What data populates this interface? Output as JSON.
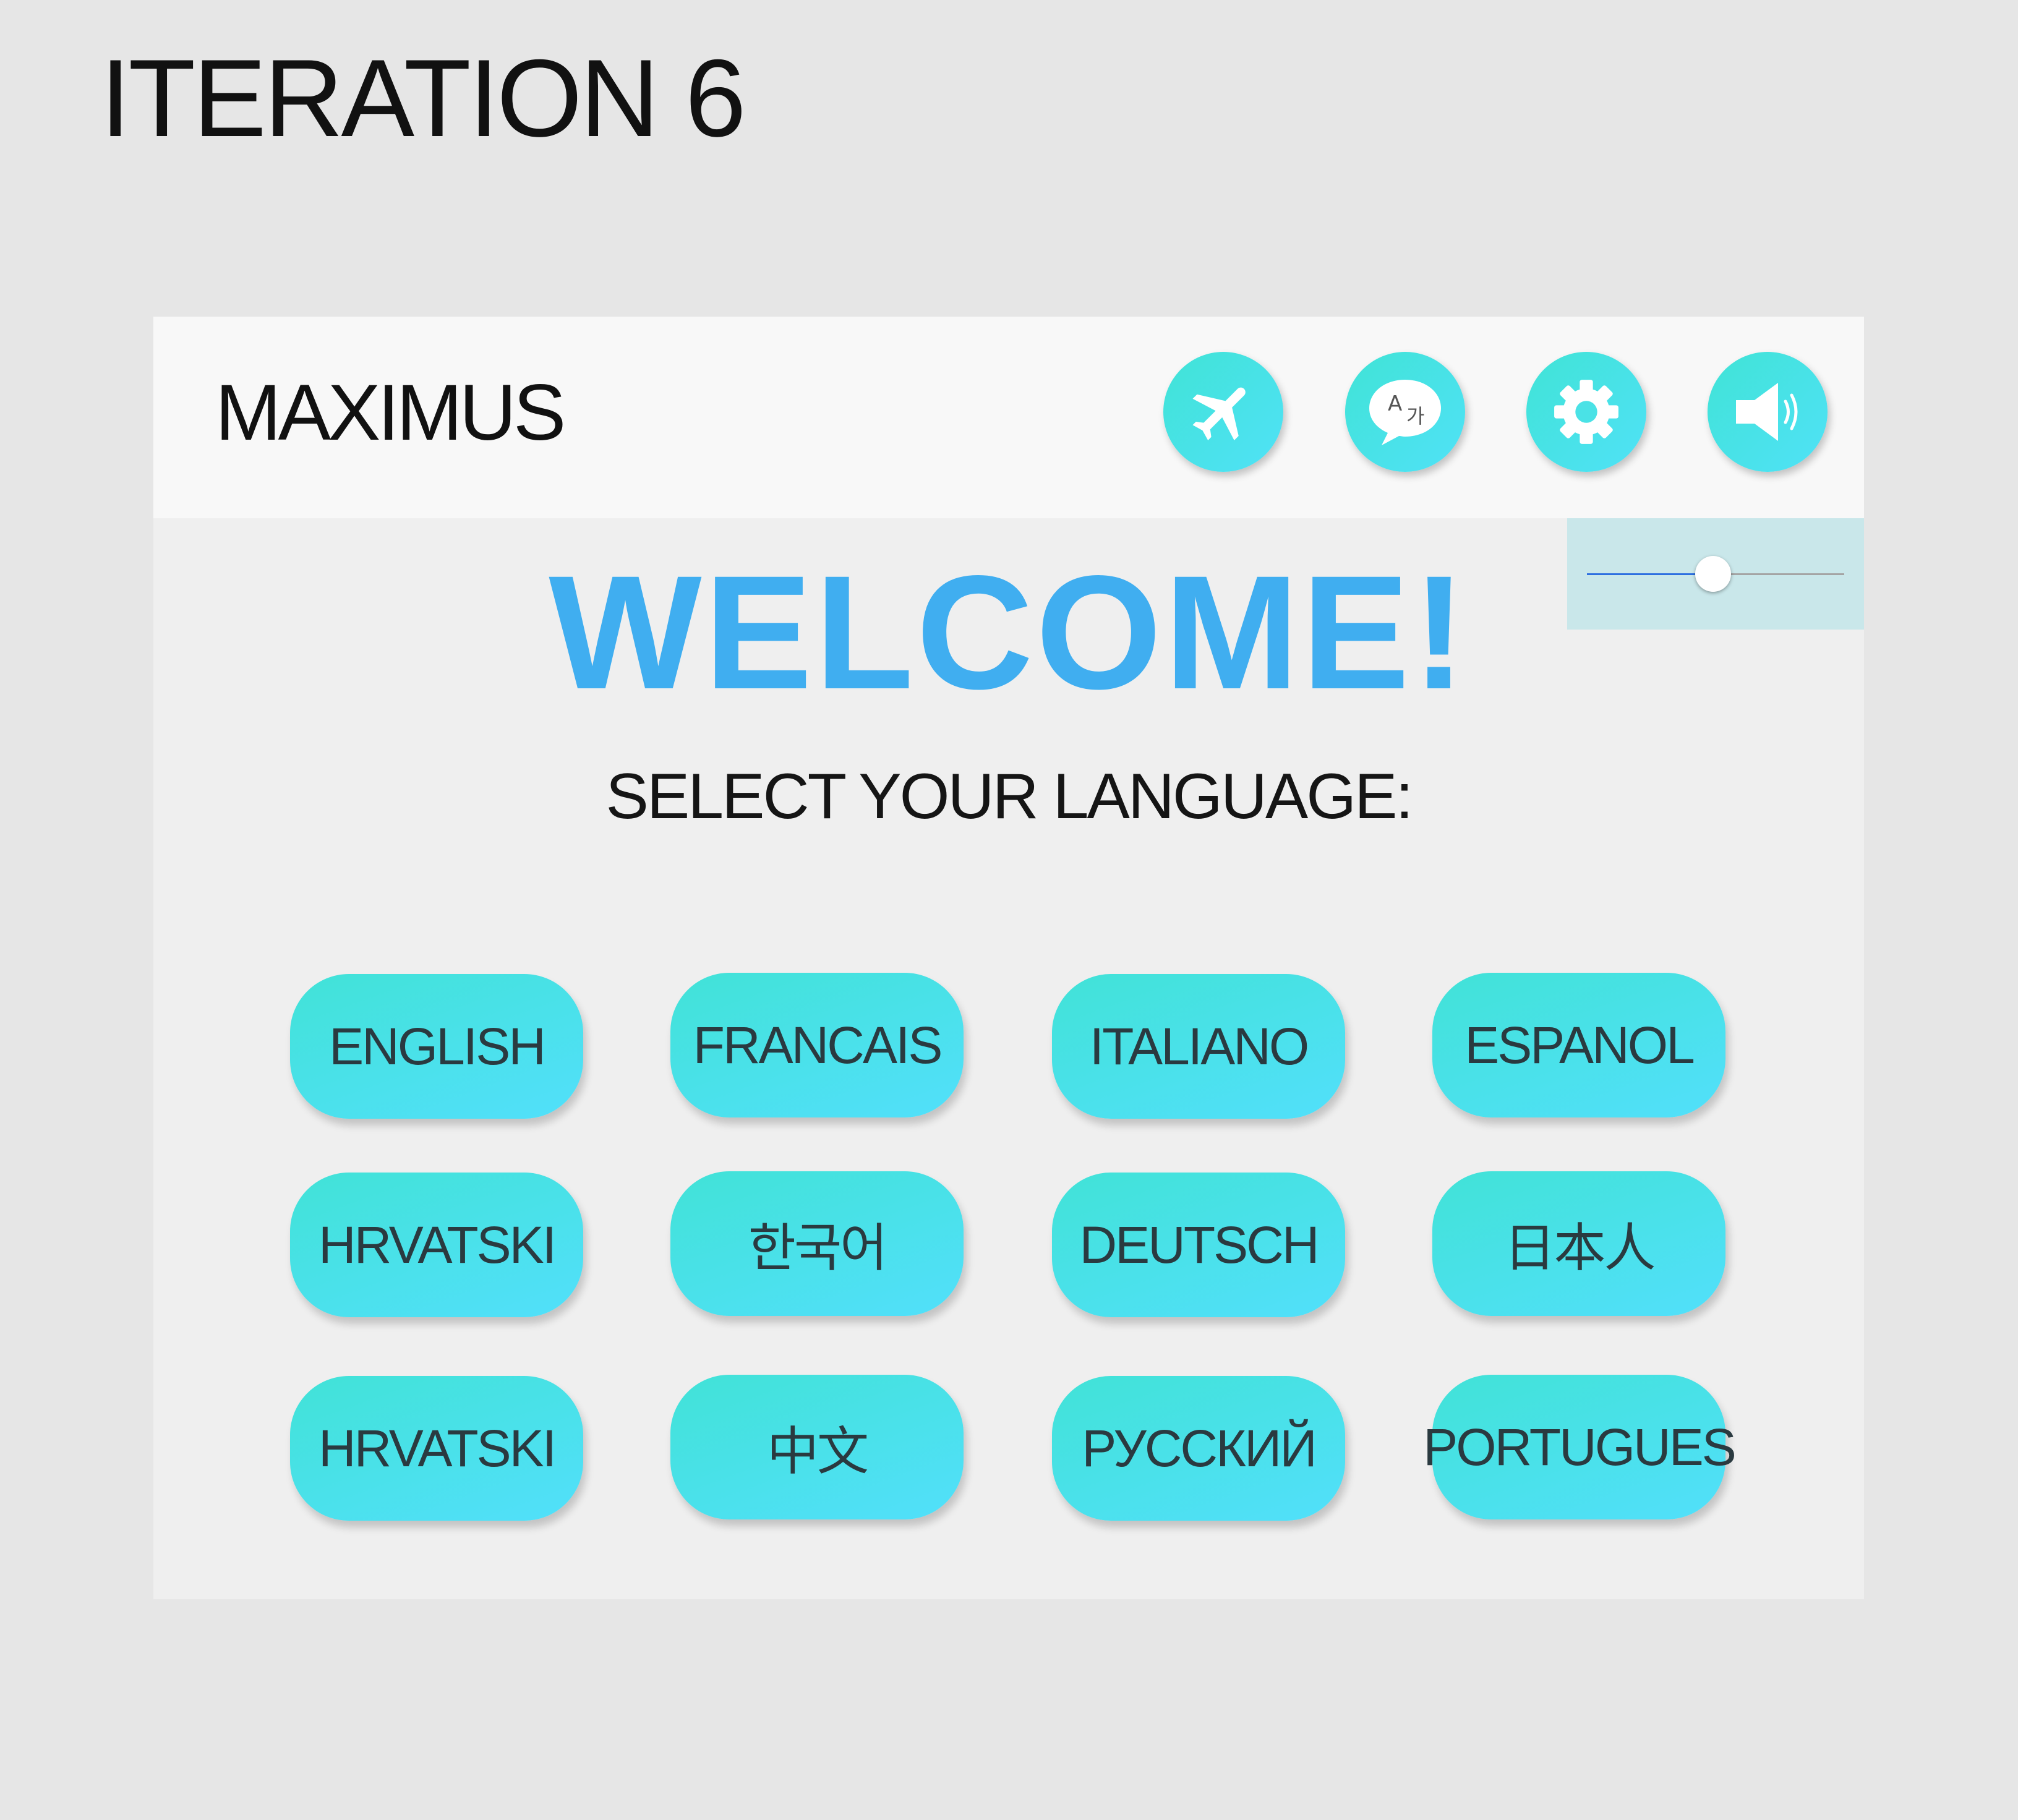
{
  "page_title": "ITERATION 6",
  "app": {
    "brand": "MAXIMUS",
    "header_icons": [
      {
        "name": "airplane-icon"
      },
      {
        "name": "translate-icon",
        "glyph_a": "A",
        "glyph_b": "가"
      },
      {
        "name": "gear-icon"
      },
      {
        "name": "speaker-icon"
      }
    ],
    "volume_level": 0.49,
    "welcome": "WELCOME!",
    "subtitle": "SELECT YOUR LANGUAGE:",
    "languages": [
      "ENGLISH",
      "FRANCAIS",
      "ITALIANO",
      "ESPANOL",
      "HRVATSKI",
      "한국어",
      "DEUTSCH",
      "日本人",
      "HRVATSKI",
      "中文",
      "РУССКИЙ",
      "PORTUGUES"
    ]
  },
  "colors": {
    "welcome": "#40aef0",
    "button_gradient_start": "#41e2d7",
    "button_gradient_end": "#52e0fb",
    "volume_popup_bg": "#c9e7ea",
    "slider_fill": "#2d6fe0"
  }
}
